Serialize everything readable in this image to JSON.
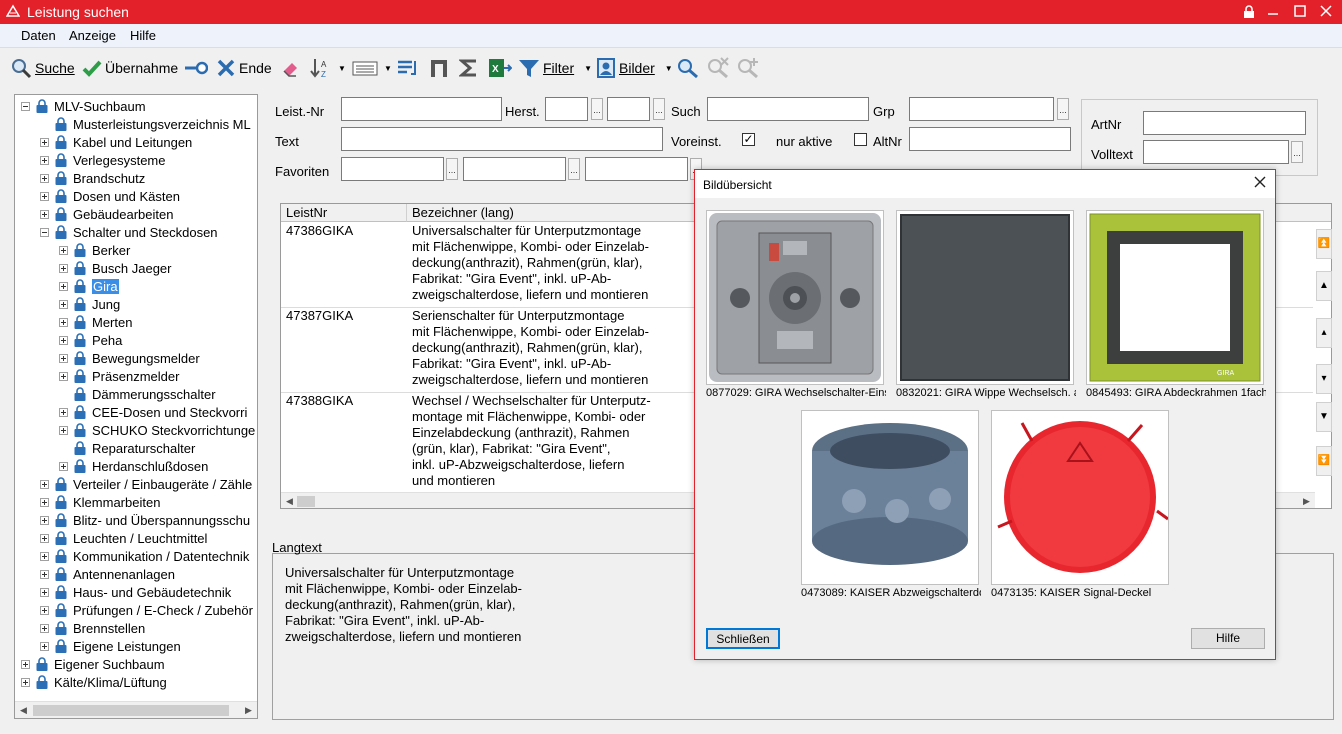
{
  "window": {
    "title": "Leistung suchen"
  },
  "menu": [
    "Daten",
    "Anzeige",
    "Hilfe"
  ],
  "toolbar": {
    "search": "Suche",
    "accept": "Übernahme",
    "end": "Ende",
    "filter": "Filter",
    "images": "Bilder"
  },
  "tree": {
    "items": [
      {
        "label": "MLV-Suchbaum",
        "level": 0,
        "expand": "minus"
      },
      {
        "label": "Musterleistungsverzeichnis ML",
        "level": 1,
        "expand": "none"
      },
      {
        "label": "Kabel und Leitungen",
        "level": 1,
        "expand": "plus"
      },
      {
        "label": "Verlegesysteme",
        "level": 1,
        "expand": "plus"
      },
      {
        "label": "Brandschutz",
        "level": 1,
        "expand": "plus"
      },
      {
        "label": "Dosen und Kästen",
        "level": 1,
        "expand": "plus"
      },
      {
        "label": "Gebäudearbeiten",
        "level": 1,
        "expand": "plus"
      },
      {
        "label": "Schalter und Steckdosen",
        "level": 1,
        "expand": "minus"
      },
      {
        "label": "Berker",
        "level": 2,
        "expand": "plus"
      },
      {
        "label": "Busch Jaeger",
        "level": 2,
        "expand": "plus"
      },
      {
        "label": "Gira",
        "level": 2,
        "expand": "plus",
        "selected": true
      },
      {
        "label": "Jung",
        "level": 2,
        "expand": "plus"
      },
      {
        "label": "Merten",
        "level": 2,
        "expand": "plus"
      },
      {
        "label": "Peha",
        "level": 2,
        "expand": "plus"
      },
      {
        "label": "Bewegungsmelder",
        "level": 2,
        "expand": "plus"
      },
      {
        "label": "Präsenzmelder",
        "level": 2,
        "expand": "plus"
      },
      {
        "label": "Dämmerungsschalter",
        "level": 2,
        "expand": "none"
      },
      {
        "label": "CEE-Dosen und Steckvorri",
        "level": 2,
        "expand": "plus"
      },
      {
        "label": "SCHUKO Steckvorrichtunge",
        "level": 2,
        "expand": "plus"
      },
      {
        "label": "Reparaturschalter",
        "level": 2,
        "expand": "none"
      },
      {
        "label": "Herdanschlußdosen",
        "level": 2,
        "expand": "plus"
      },
      {
        "label": "Verteiler / Einbaugeräte / Zähle",
        "level": 1,
        "expand": "plus"
      },
      {
        "label": "Klemmarbeiten",
        "level": 1,
        "expand": "plus"
      },
      {
        "label": "Blitz- und Überspannungsschu",
        "level": 1,
        "expand": "plus"
      },
      {
        "label": "Leuchten / Leuchtmittel",
        "level": 1,
        "expand": "plus"
      },
      {
        "label": "Kommunikation / Datentechnik",
        "level": 1,
        "expand": "plus"
      },
      {
        "label": "Antennenanlagen",
        "level": 1,
        "expand": "plus"
      },
      {
        "label": "Haus- und Gebäudetechnik",
        "level": 1,
        "expand": "plus"
      },
      {
        "label": "Prüfungen / E-Check / Zubehör",
        "level": 1,
        "expand": "plus"
      },
      {
        "label": "Brennstellen",
        "level": 1,
        "expand": "plus"
      },
      {
        "label": "Eigene Leistungen",
        "level": 1,
        "expand": "plus"
      },
      {
        "label": "Eigener Suchbaum",
        "level": 0,
        "expand": "plus"
      },
      {
        "label": "Kälte/Klima/Lüftung",
        "level": 0,
        "expand": "plus"
      }
    ]
  },
  "filters": {
    "leist_nr": "Leist.-Nr",
    "herst": "Herst.",
    "such": "Such",
    "grp": "Grp",
    "text": "Text",
    "voreinst": "Voreinst.",
    "voreinst_checked": true,
    "nur_aktive": "nur aktive",
    "nur_aktive_checked": false,
    "altnr": "AltNr",
    "favoriten": "Favoriten",
    "artnr": "ArtNr",
    "volltext": "Volltext",
    "dots": "..."
  },
  "grid": {
    "columns": [
      "LeistNr",
      "Bezeichner (lang)"
    ],
    "rows": [
      {
        "nr": "47386GIKA",
        "text": "Universalschalter für Unterputzmontage\nmit Flächenwippe, Kombi- oder Einzelab-\ndeckung(anthrazit), Rahmen(grün, klar),\nFabrikat: \"Gira Event\", inkl. uP-Ab-\nzweigschalterdose, liefern und montieren"
      },
      {
        "nr": "47387GIKA",
        "text": "Serienschalter für Unterputzmontage\nmit Flächenwippe, Kombi- oder Einzelab-\ndeckung(anthrazit), Rahmen(grün, klar),\nFabrikat: \"Gira Event\", inkl. uP-Ab-\nzweigschalterdose, liefern und montieren"
      },
      {
        "nr": "47388GIKA",
        "text": "Wechsel / Wechselschalter für Unterputz-\nmontage mit Flächenwippe, Kombi- oder\nEinzelabdeckung (anthrazit), Rahmen\n(grün, klar), Fabrikat: \"Gira Event\",\ninkl. uP-Abzweigschalterdose, liefern\nund montieren"
      }
    ]
  },
  "langtext": {
    "label": "Langtext",
    "text": "Universalschalter für Unterputzmontage\nmit Flächenwippe, Kombi- oder Einzelab-\ndeckung(anthrazit), Rahmen(grün, klar),\nFabrikat: \"Gira Event\", inkl. uP-Ab-\nzweigschalterdose, liefern und montieren"
  },
  "dialog": {
    "title": "Bildübersicht",
    "images": [
      {
        "caption": "0877029: GIRA Wechselschalter-Eins"
      },
      {
        "caption": "0832021: GIRA Wippe Wechselsch. a"
      },
      {
        "caption": "0845493: GIRA Abdeckrahmen 1fach"
      },
      {
        "caption": "0473089: KAISER Abzweigschalterdo"
      },
      {
        "caption": "0473135: KAISER Signal-Deckel"
      }
    ],
    "close_button": "Schließen",
    "help_button": "Hilfe",
    "frame_brand": "GIRA"
  },
  "colors": {
    "titlebar": "#e3212b",
    "selection": "#3b8ee6",
    "frame_green": "#a9c23a"
  }
}
